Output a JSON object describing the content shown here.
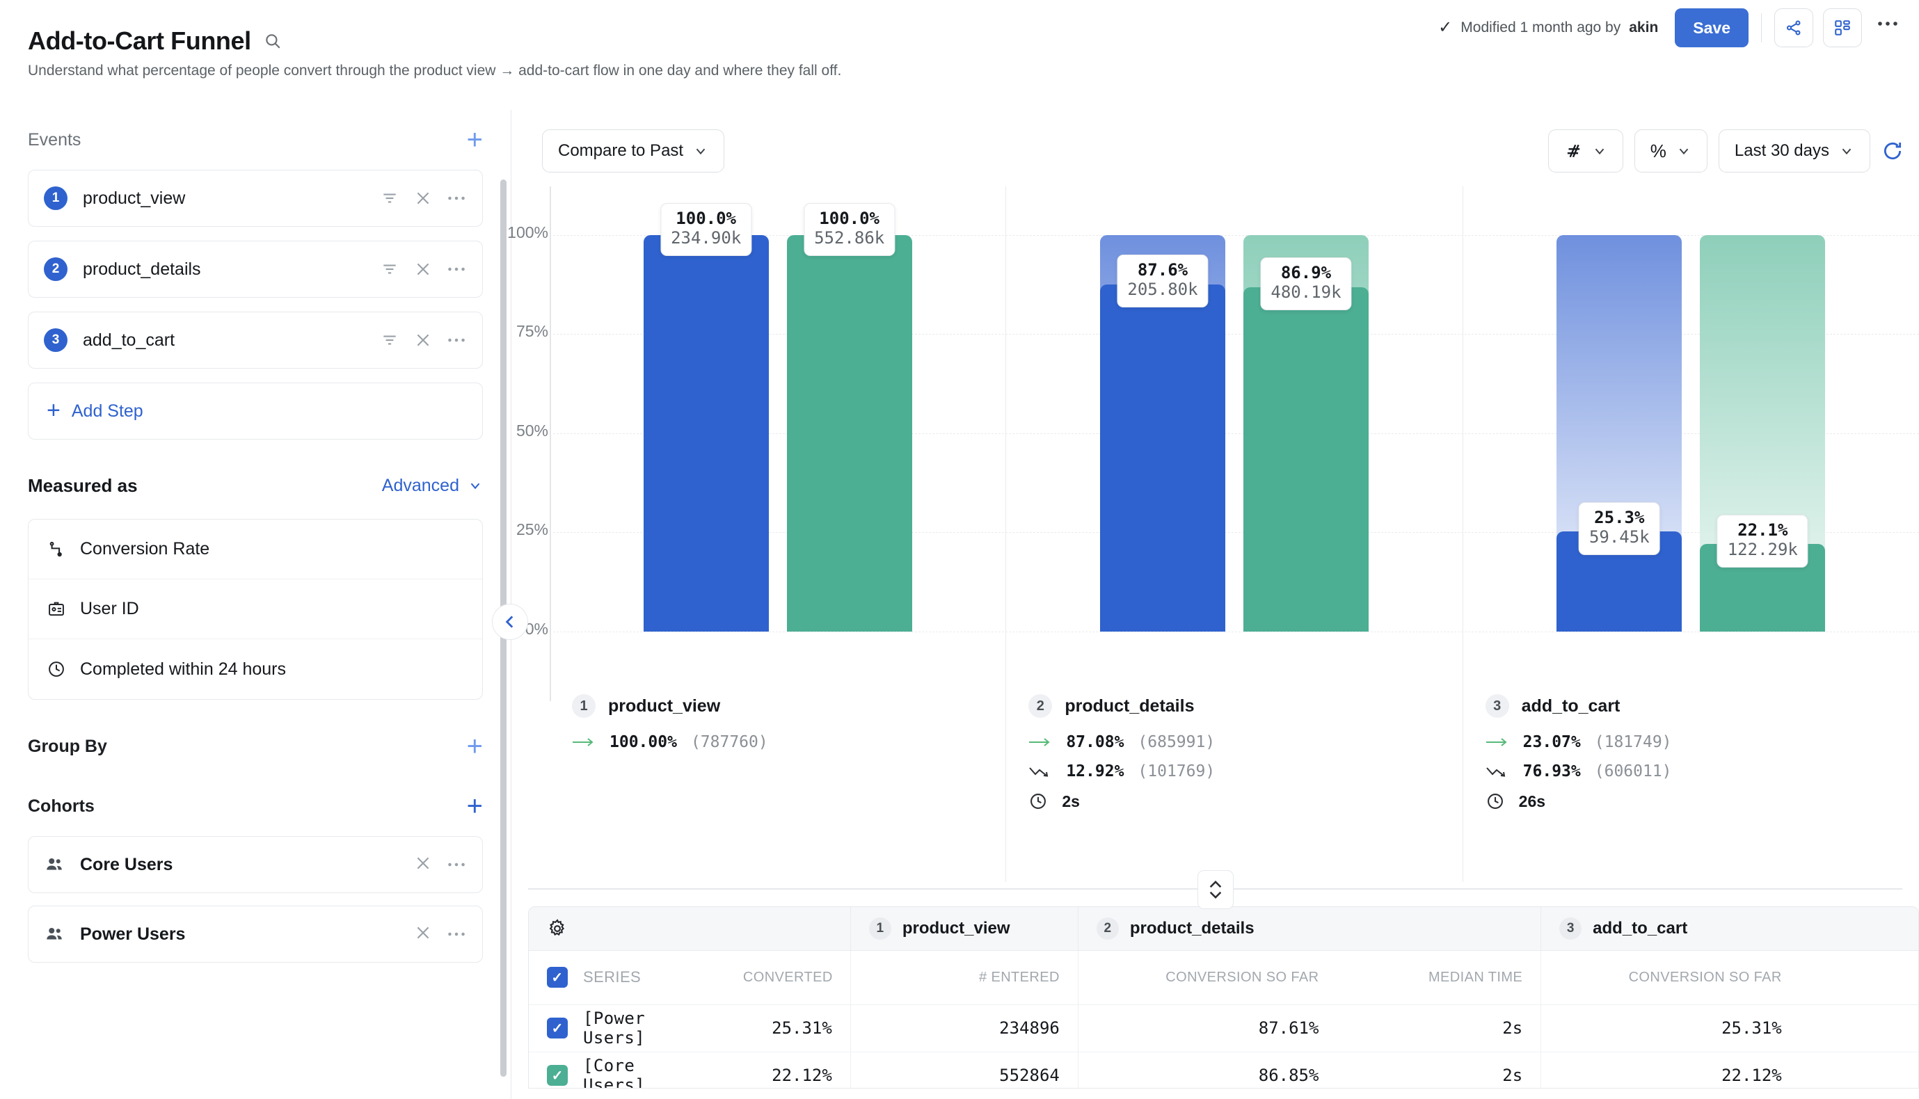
{
  "header": {
    "title": "Add-to-Cart Funnel",
    "subtitle": "Understand what percentage of people convert through the product view → add-to-cart flow in one day and where they fall off.",
    "modified_text": "Modified 1 month ago by ",
    "modified_user": "akin",
    "save_label": "Save",
    "accent_color": "#3b6ed4"
  },
  "sidebar": {
    "events_label": "Events",
    "events": [
      {
        "num": "1",
        "name": "product_view"
      },
      {
        "num": "2",
        "name": "product_details"
      },
      {
        "num": "3",
        "name": "add_to_cart"
      }
    ],
    "add_step_label": "Add Step",
    "measured_as_label": "Measured as",
    "advanced_label": "Advanced",
    "measures": [
      {
        "icon": "conversion-rate-icon",
        "label": "Conversion Rate"
      },
      {
        "icon": "user-id-icon",
        "label": "User ID"
      },
      {
        "icon": "clock-icon",
        "label": "Completed within 24 hours"
      }
    ],
    "group_by_label": "Group By",
    "cohorts_label": "Cohorts",
    "cohorts": [
      {
        "name": "Core Users"
      },
      {
        "name": "Power Users"
      }
    ]
  },
  "toolbar": {
    "compare_label": "Compare to Past",
    "chart_type_label": "",
    "units_label": "%",
    "date_range_label": "Last 30 days"
  },
  "chart_data": {
    "type": "bar",
    "title": "",
    "xlabel": "",
    "ylabel": "",
    "ylim": [
      0,
      100
    ],
    "grid": true,
    "legend_position": "table",
    "tick_labels": [
      "100%",
      "75%",
      "50%",
      "25%",
      "0%"
    ],
    "tick_values": [
      100,
      75,
      50,
      25,
      0
    ],
    "categories": [
      "product_view",
      "product_details",
      "add_to_cart"
    ],
    "series": [
      {
        "name": "[Power Users]",
        "color": "#2f62ce",
        "values": [
          100.0,
          87.6,
          25.3
        ],
        "counts": [
          "234.90k",
          "205.80k",
          "59.45k"
        ],
        "labels": [
          "100.0%",
          "87.6%",
          "25.3%"
        ]
      },
      {
        "name": "[Core Users]",
        "color": "#4cae93",
        "values": [
          100.0,
          86.9,
          22.1
        ],
        "counts": [
          "552.86k",
          "480.19k",
          "122.29k"
        ],
        "labels": [
          "100.0%",
          "86.9%",
          "22.1%"
        ]
      }
    ],
    "steps": [
      {
        "num": "1",
        "name": "product_view",
        "converted_pct": "100.00%",
        "converted_count": "(787760)",
        "dropped_pct": "",
        "dropped_count": "",
        "median_time": ""
      },
      {
        "num": "2",
        "name": "product_details",
        "converted_pct": "87.08%",
        "converted_count": "(685991)",
        "dropped_pct": "12.92%",
        "dropped_count": "(101769)",
        "median_time": "2s"
      },
      {
        "num": "3",
        "name": "add_to_cart",
        "converted_pct": "23.07%",
        "converted_count": "(181749)",
        "dropped_pct": "76.93%",
        "dropped_count": "(606011)",
        "median_time": "26s"
      }
    ]
  },
  "table": {
    "group_headers": [
      {
        "num": "1",
        "name": "product_view"
      },
      {
        "num": "2",
        "name": "product_details"
      },
      {
        "num": "3",
        "name": "add_to_cart"
      }
    ],
    "sub_headers": {
      "series": "SERIES",
      "converted": "CONVERTED",
      "entered": "# ENTERED",
      "conv_so_far_1": "CONVERSION SO FAR",
      "median_time_1": "MEDIAN TIME",
      "conv_so_far_2": "CONVERSION SO FAR",
      "clipped": "CONV"
    },
    "rows": [
      {
        "series": "[Power Users]",
        "checkbox_color": "blue",
        "converted": "25.31%",
        "entered": "234896",
        "conv_so_far_1": "87.61%",
        "median_time_1": "2s",
        "conv_so_far_2": "25.31%"
      },
      {
        "series": "[Core Users]",
        "checkbox_color": "green",
        "converted": "22.12%",
        "entered": "552864",
        "conv_so_far_1": "86.85%",
        "median_time_1": "2s",
        "conv_so_far_2": "22.12%"
      }
    ]
  }
}
